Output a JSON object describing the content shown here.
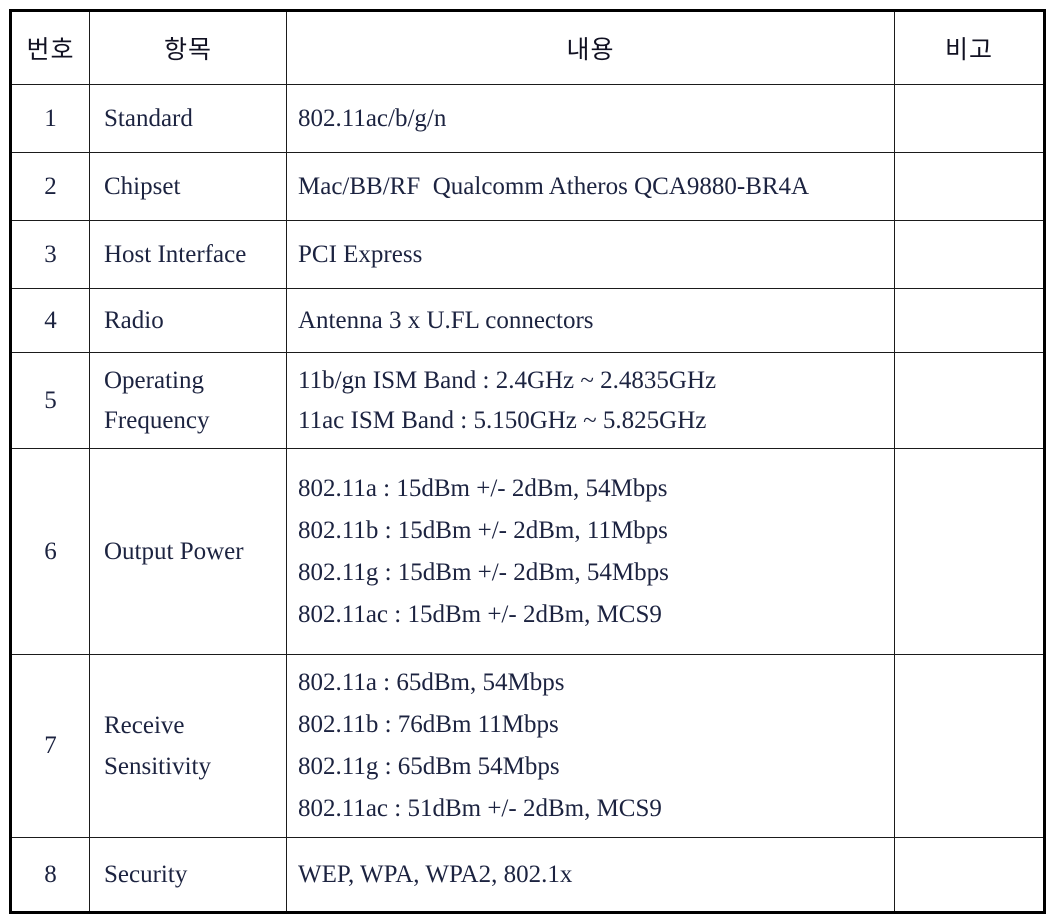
{
  "table": {
    "columns": [
      {
        "key": "no",
        "label": "번호"
      },
      {
        "key": "item",
        "label": "항목"
      },
      {
        "key": "content",
        "label": "내용"
      },
      {
        "key": "remark",
        "label": "비고"
      }
    ],
    "header_background": "#cccccc",
    "border_color": "#000000",
    "rows": [
      {
        "no": "1",
        "item": [
          "Standard"
        ],
        "content": [
          "802.11ac/b/g/n"
        ],
        "remark": ""
      },
      {
        "no": "2",
        "item": [
          "Chipset"
        ],
        "content": [
          "Mac/BB/RF  Qualcomm Atheros QCA9880-BR4A"
        ],
        "remark": ""
      },
      {
        "no": "3",
        "item": [
          "Host Interface"
        ],
        "content": [
          "PCI Express"
        ],
        "remark": ""
      },
      {
        "no": "4",
        "item": [
          "Radio"
        ],
        "content": [
          "Antenna 3 x U.FL connectors"
        ],
        "remark": ""
      },
      {
        "no": "5",
        "item": [
          "Operating",
          "Frequency"
        ],
        "content": [
          "11b/gn ISM Band : 2.4GHz ~ 2.4835GHz",
          "11ac ISM Band : 5.150GHz ~ 5.825GHz"
        ],
        "remark": ""
      },
      {
        "no": "6",
        "item": [
          "Output Power"
        ],
        "content": [
          "802.11a : 15dBm +/- 2dBm, 54Mbps",
          "802.11b : 15dBm +/- 2dBm, 11Mbps",
          "802.11g : 15dBm +/- 2dBm, 54Mbps",
          "802.11ac : 15dBm +/- 2dBm, MCS9"
        ],
        "remark": ""
      },
      {
        "no": "7",
        "item": [
          "Receive",
          "Sensitivity"
        ],
        "content": [
          "802.11a : 65dBm, 54Mbps",
          "802.11b : 76dBm 11Mbps",
          "802.11g : 65dBm 54Mbps",
          "802.11ac : 51dBm +/- 2dBm, MCS9"
        ],
        "remark": ""
      },
      {
        "no": "8",
        "item": [
          "Security"
        ],
        "content": [
          "WEP, WPA, WPA2, 802.1x"
        ],
        "remark": ""
      }
    ]
  }
}
